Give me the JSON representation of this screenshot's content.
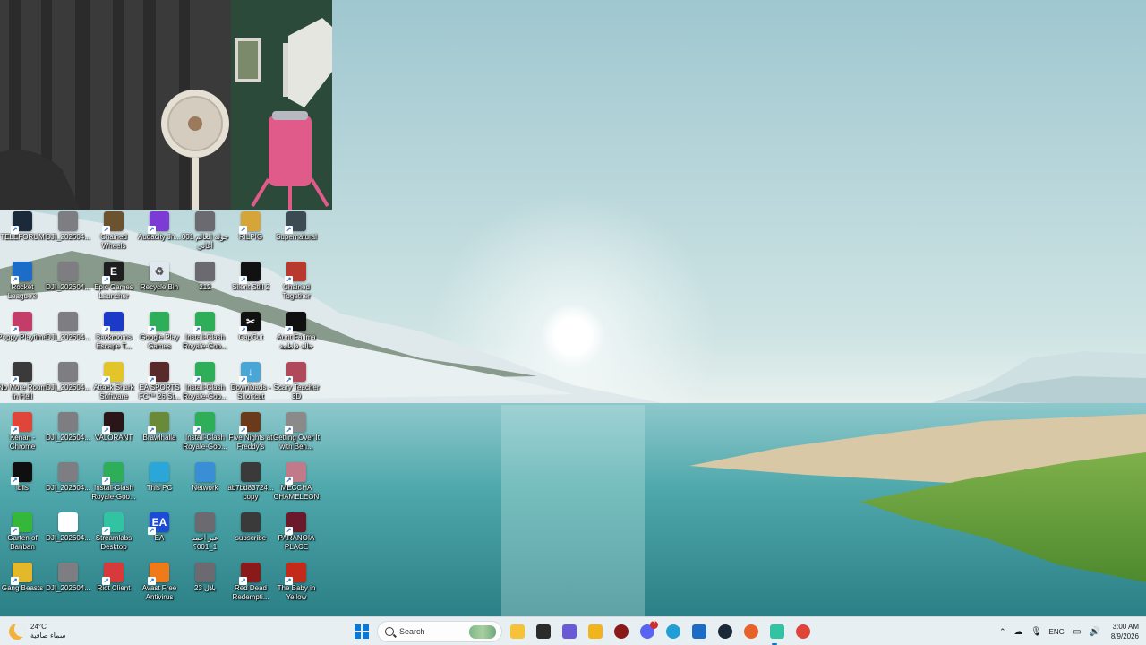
{
  "desktop_icons": [
    {
      "label": "TELEFORUM",
      "color": "#1b2a3a",
      "glyph": "",
      "shortcut": true
    },
    {
      "label": "DJI_202604...",
      "color": "#7d7d82",
      "glyph": "",
      "shortcut": false
    },
    {
      "label": "Chained Wheels",
      "color": "#6b5330",
      "glyph": "",
      "shortcut": true
    },
    {
      "label": "Audacity Jn...",
      "color": "#7b3bd4",
      "glyph": "",
      "shortcut": true
    },
    {
      "label": "جولة العالم 001 أغاني",
      "color": "#6a6a70",
      "glyph": "",
      "shortcut": false
    },
    {
      "label": "RILPIG",
      "color": "#d6a53a",
      "glyph": "",
      "shortcut": true
    },
    {
      "label": "Supernatural",
      "color": "#3c4a52",
      "glyph": "",
      "shortcut": true
    },
    {
      "label": "Rocket League®",
      "color": "#1d6cc8",
      "glyph": "",
      "shortcut": true
    },
    {
      "label": "DJI_202604...",
      "color": "#7d7d82",
      "glyph": "",
      "shortcut": false
    },
    {
      "label": "Epic Games Launcher",
      "color": "#1e1e1e",
      "glyph": "E",
      "shortcut": true
    },
    {
      "label": "Recycle Bin",
      "color": "#dfe8ee",
      "glyph": "♻",
      "shortcut": false
    },
    {
      "label": "212",
      "color": "#6a6a70",
      "glyph": "",
      "shortcut": false
    },
    {
      "label": "Silent Still 2",
      "color": "#111111",
      "glyph": "",
      "shortcut": true
    },
    {
      "label": "Chained Together",
      "color": "#b83a2e",
      "glyph": "",
      "shortcut": true
    },
    {
      "label": "Poppy Playtime",
      "color": "#c43c68",
      "glyph": "",
      "shortcut": true
    },
    {
      "label": "DJI_202604...",
      "color": "#7d7d82",
      "glyph": "",
      "shortcut": false
    },
    {
      "label": "Backrooms Escape T...",
      "color": "#1b3ac8",
      "glyph": "",
      "shortcut": true
    },
    {
      "label": "Google Play Games",
      "color": "#2fae5a",
      "glyph": "",
      "shortcut": true
    },
    {
      "label": "Install-Clash Royale-Goo...",
      "color": "#2fae5a",
      "glyph": "",
      "shortcut": true
    },
    {
      "label": "CapCut",
      "color": "#111111",
      "glyph": "✂",
      "shortcut": true
    },
    {
      "label": "Aunt Fatima خالة فاطمة",
      "color": "#101010",
      "glyph": "",
      "shortcut": true
    },
    {
      "label": "No More Room in Hell",
      "color": "#3a3a3a",
      "glyph": "",
      "shortcut": true
    },
    {
      "label": "DJI_202604...",
      "color": "#7d7d82",
      "glyph": "",
      "shortcut": false
    },
    {
      "label": "Attack Shark Software",
      "color": "#e3c42a",
      "glyph": "",
      "shortcut": true
    },
    {
      "label": "EA SPORTS FC™ 26 St...",
      "color": "#5a2a2a",
      "glyph": "",
      "shortcut": true
    },
    {
      "label": "Install-Clash Royale-Goo...",
      "color": "#2fae5a",
      "glyph": "",
      "shortcut": true
    },
    {
      "label": "Downloads - Shortcut",
      "color": "#4aa6d6",
      "glyph": "↓",
      "shortcut": true
    },
    {
      "label": "Scary Teacher 3D",
      "color": "#b04a5a",
      "glyph": "",
      "shortcut": true
    },
    {
      "label": "Kenan - Chrome",
      "color": "#e0453a",
      "glyph": "",
      "shortcut": true
    },
    {
      "label": "DJI_202604...",
      "color": "#7d7d82",
      "glyph": "",
      "shortcut": false
    },
    {
      "label": "VALORANT",
      "color": "#2a1518",
      "glyph": "",
      "shortcut": true
    },
    {
      "label": "Brawlhalla",
      "color": "#6a8a3a",
      "glyph": "",
      "shortcut": true
    },
    {
      "label": "Install-Clash Royale-Goo...",
      "color": "#2fae5a",
      "glyph": "",
      "shortcut": true
    },
    {
      "label": "Five Nights at Freddy's",
      "color": "#6a3a1a",
      "glyph": "",
      "shortcut": true
    },
    {
      "label": "Getting Over It with Ben...",
      "color": "#8a8a8a",
      "glyph": "",
      "shortcut": true
    },
    {
      "label": "ibiis",
      "color": "#0f0f0f",
      "glyph": "",
      "shortcut": true
    },
    {
      "label": "DJI_202604...",
      "color": "#7d7d82",
      "glyph": "",
      "shortcut": false
    },
    {
      "label": "Install-Clash Royale-Goo...",
      "color": "#2fae5a",
      "glyph": "",
      "shortcut": true
    },
    {
      "label": "This PC",
      "color": "#2aa6d9",
      "glyph": "",
      "shortcut": false
    },
    {
      "label": "Network",
      "color": "#3a8ed6",
      "glyph": "",
      "shortcut": false
    },
    {
      "label": "ab7bd83724... copy",
      "color": "#3a3a3a",
      "glyph": "",
      "shortcut": false
    },
    {
      "label": "MECCHA CHAMELEON",
      "color": "#c07a8a",
      "glyph": "",
      "shortcut": true
    },
    {
      "label": "Garten of Banban",
      "color": "#35b83a",
      "glyph": "",
      "shortcut": true
    },
    {
      "label": "DJI_202604...",
      "color": "#ffffff",
      "glyph": "",
      "shortcut": false
    },
    {
      "label": "Streamlabs Desktop",
      "color": "#31c3a2",
      "glyph": "",
      "shortcut": true
    },
    {
      "label": "EA",
      "color": "#1c4bd6",
      "glyph": "EA",
      "shortcut": true
    },
    {
      "label": "عبر أحمد 1_001؟",
      "color": "#6a6a70",
      "glyph": "",
      "shortcut": false
    },
    {
      "label": "subscribe",
      "color": "#3a3a3a",
      "glyph": "",
      "shortcut": false
    },
    {
      "label": "PARANOIA PLACE",
      "color": "#6a1a2a",
      "glyph": "",
      "shortcut": true
    },
    {
      "label": "Gang Beasts",
      "color": "#e3b82a",
      "glyph": "",
      "shortcut": true
    },
    {
      "label": "DJI_202604...",
      "color": "#7d7d82",
      "glyph": "",
      "shortcut": false
    },
    {
      "label": "Riot Client",
      "color": "#d63a3a",
      "glyph": "",
      "shortcut": true
    },
    {
      "label": "Avast Free Antivirus",
      "color": "#f07a1a",
      "glyph": "",
      "shortcut": true
    },
    {
      "label": "23 بلال",
      "color": "#6a6a70",
      "glyph": "",
      "shortcut": false
    },
    {
      "label": "Red Dead Redempti...",
      "color": "#8a1a1a",
      "glyph": "",
      "shortcut": true
    },
    {
      "label": "The Baby in Yellow",
      "color": "#c42a1a",
      "glyph": "",
      "shortcut": true
    }
  ],
  "taskbar": {
    "weather": {
      "temp": "24°C",
      "condition": "سماء صافية",
      "icon": "crescent-moon-icon"
    },
    "search_placeholder": "Search",
    "apps": [
      {
        "name": "file-explorer-icon",
        "color": "#f5c23a",
        "active": false,
        "badge": ""
      },
      {
        "name": "task-view-icon",
        "color": "#2b2b2b",
        "active": false,
        "badge": ""
      },
      {
        "name": "store-icon",
        "color": "#6a5ad6",
        "active": false,
        "badge": ""
      },
      {
        "name": "folder-icon",
        "color": "#f2b41e",
        "active": false,
        "badge": ""
      },
      {
        "name": "obs-icon",
        "color": "#8a1a1a",
        "active": false,
        "badge": ""
      },
      {
        "name": "discord-icon",
        "color": "#5865f2",
        "active": false,
        "badge": "7"
      },
      {
        "name": "edge-icon",
        "color": "#1f9fd6",
        "active": false,
        "badge": ""
      },
      {
        "name": "microsoft-store-icon",
        "color": "#1c6bc4",
        "active": false,
        "badge": ""
      },
      {
        "name": "steam-icon",
        "color": "#1b2838",
        "active": false,
        "badge": ""
      },
      {
        "name": "firefox-icon",
        "color": "#e8612a",
        "active": false,
        "badge": ""
      },
      {
        "name": "streamlabs-icon",
        "color": "#31c3a2",
        "active": true,
        "badge": ""
      },
      {
        "name": "chrome-icon",
        "color": "#e0453a",
        "active": false,
        "badge": ""
      }
    ],
    "tray": {
      "language": "ENG",
      "time": "3:00 AM",
      "date": "8/9/2026"
    }
  }
}
